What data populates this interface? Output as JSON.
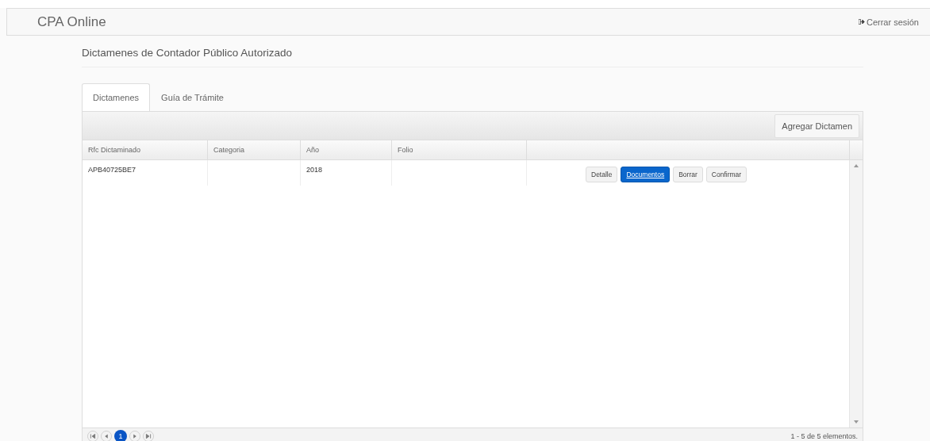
{
  "navbar": {
    "brand": "CPA Online",
    "logout": "Cerrar sesión"
  },
  "page_title": "Dictamenes de Contador Público Autorizado",
  "tabs": [
    {
      "label": "Dictamenes",
      "selected": true
    },
    {
      "label": "Guía de Trámite",
      "selected": false
    }
  ],
  "toolbar": {
    "add_button": "Agregar Dictamen"
  },
  "table": {
    "columns": [
      "Rfc Dictaminado",
      "Categoria",
      "Año",
      "Folio"
    ],
    "rows": [
      {
        "rfc": "APB40725BE7",
        "categoria": "",
        "anio": "2018",
        "folio": "",
        "actions": [
          {
            "label": "Detalle",
            "selected": false
          },
          {
            "label": "Documentos",
            "selected": true
          },
          {
            "label": "Borrar",
            "selected": false
          },
          {
            "label": "Confirmar",
            "selected": false
          }
        ]
      }
    ]
  },
  "pager": {
    "pages": [
      {
        "label": "1",
        "selected": true
      }
    ],
    "summary": "1 - 5 de 5 elementos."
  }
}
